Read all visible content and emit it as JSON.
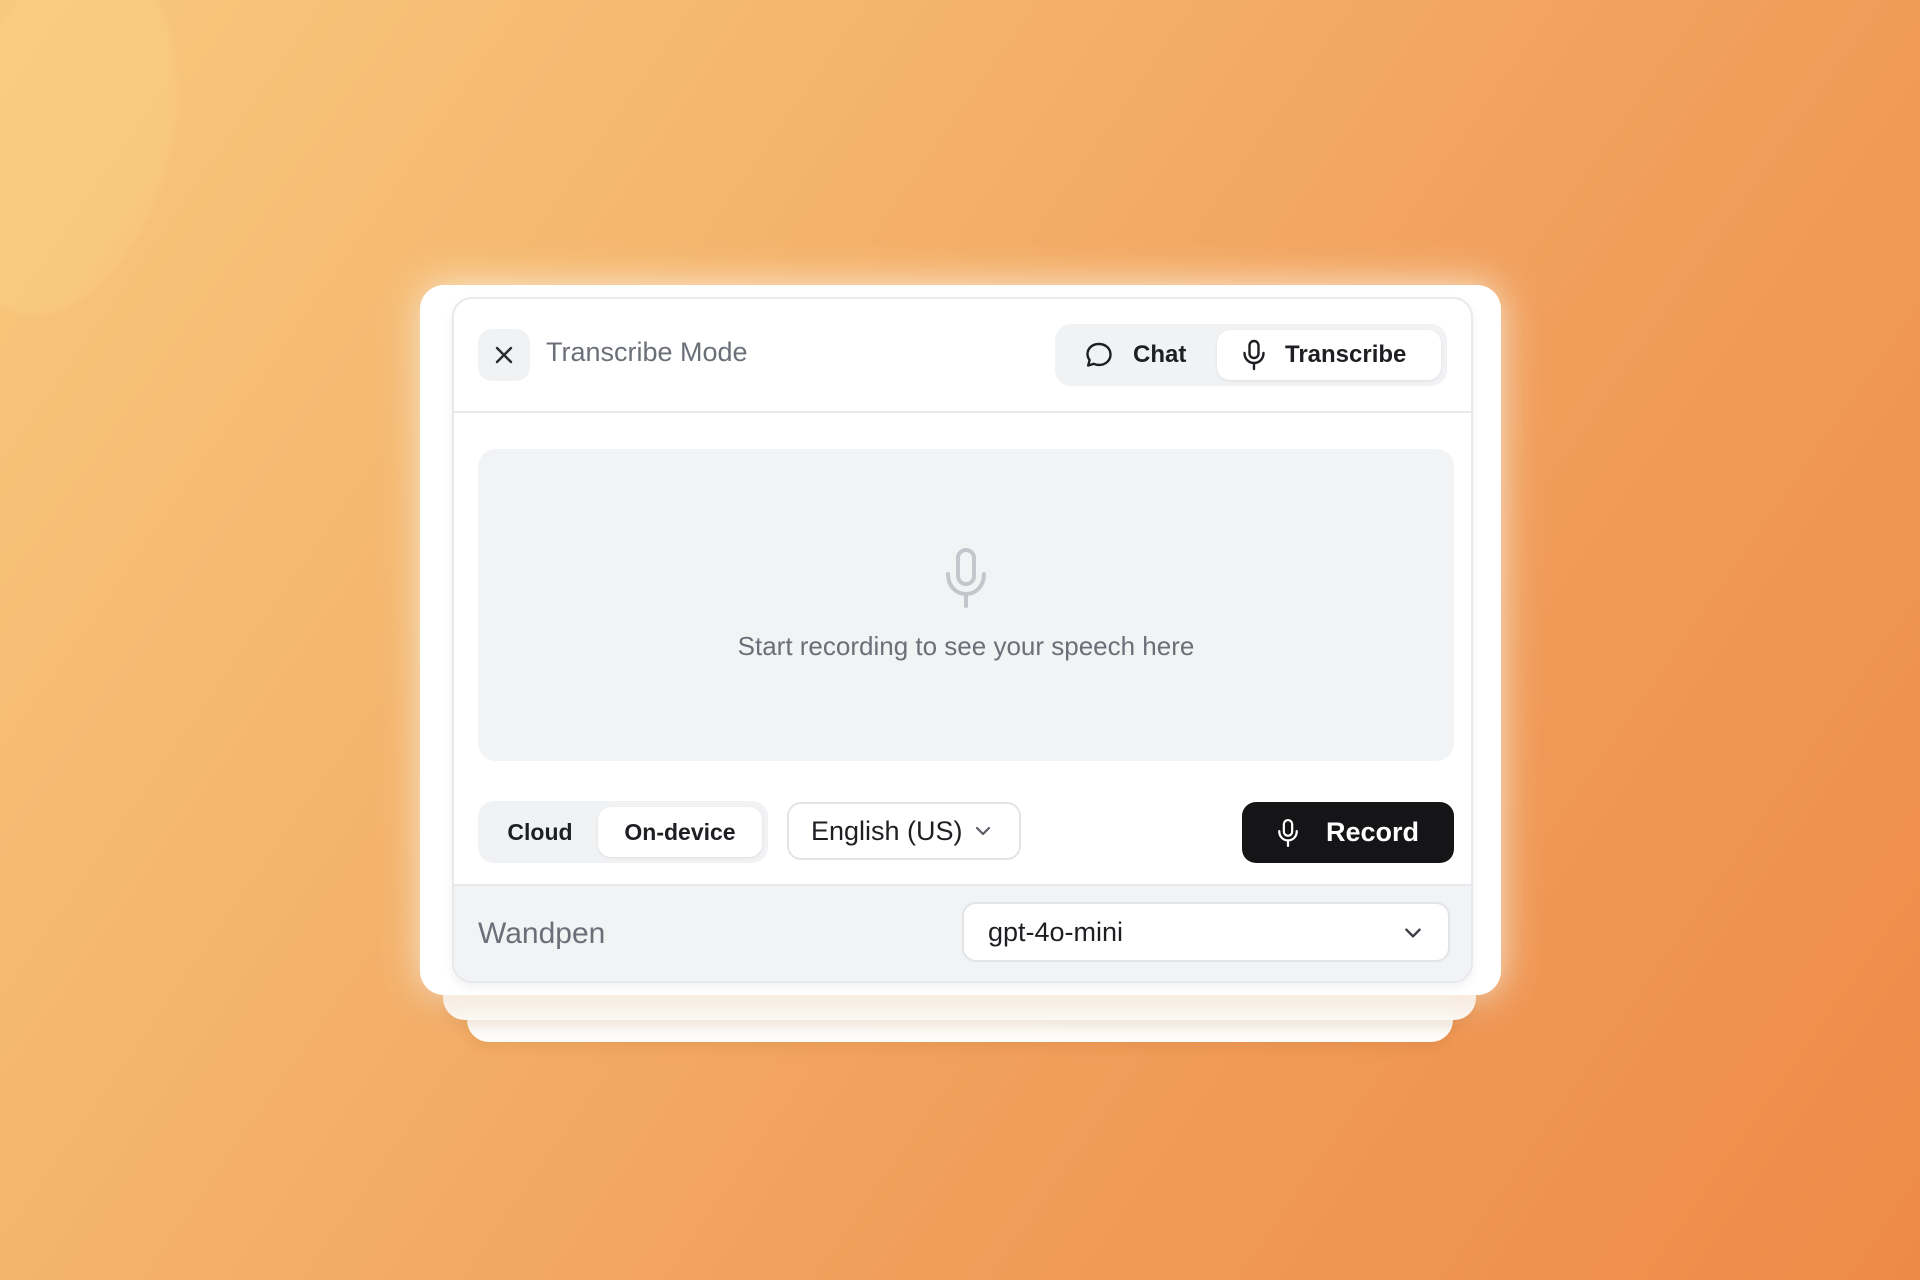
{
  "header": {
    "title": "Transcribe Mode",
    "close_icon": "close-icon",
    "tabs": [
      {
        "label": "Chat",
        "icon": "chat-bubble-icon",
        "selected": false
      },
      {
        "label": "Transcribe",
        "icon": "microphone-icon",
        "selected": true
      }
    ]
  },
  "transcript": {
    "icon": "microphone-icon",
    "placeholder": "Start recording to see your speech here"
  },
  "controls": {
    "engine_options": [
      {
        "label": "Cloud",
        "selected": false
      },
      {
        "label": "On-device",
        "selected": true
      }
    ],
    "language": "English (US)",
    "record_label": "Record",
    "record_icon": "microphone-icon"
  },
  "footer": {
    "title": "Wandpen",
    "model": "gpt-4o-mini"
  },
  "colors": {
    "accent_dark": "#151518",
    "muted_text": "#6b6f78",
    "surface": "#f2f3f5",
    "background_start": "#f8c97d",
    "background_end": "#ee8a48"
  }
}
